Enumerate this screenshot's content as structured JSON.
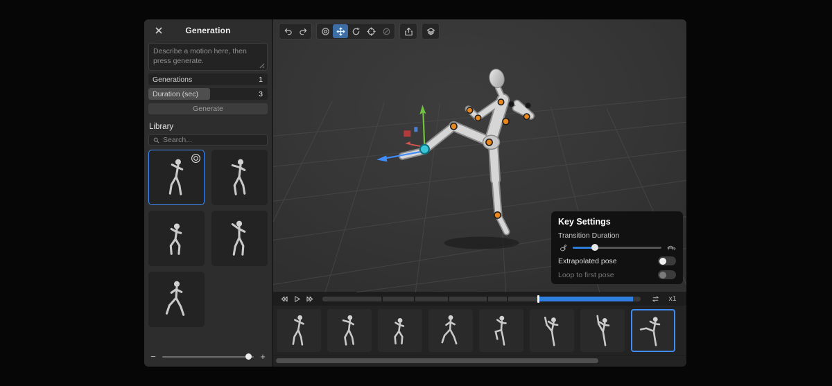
{
  "colors": {
    "accent_blue": "#3f8cfa",
    "timeline_blue": "#2f7fe0",
    "gizmo_green": "#6fc23d",
    "gizmo_blue": "#3f8cfa",
    "gizmo_red": "#d8544f",
    "joint_orange": "#e8871e",
    "selected_joint_cyan": "#39c6d8",
    "panel_bg": "#2d2d2d",
    "viewport_bg": "#363636"
  },
  "generation_panel": {
    "title": "Generation",
    "prompt_placeholder": "Describe a motion here, then press generate.",
    "generations_label": "Generations",
    "generations_value": "1",
    "duration_label": "Duration (sec)",
    "duration_value": "3",
    "duration_fill_percent": 52,
    "generate_label": "Generate",
    "library_title": "Library",
    "search_placeholder": "Search...",
    "library_items": [
      {
        "pose": "guard",
        "selected": true
      },
      {
        "pose": "jab",
        "selected": false
      },
      {
        "pose": "crouch",
        "selected": false
      },
      {
        "pose": "reach",
        "selected": false
      },
      {
        "pose": "step",
        "selected": false
      }
    ],
    "zoom_minus_label": "−",
    "zoom_plus_label": "+",
    "zoom_percent": 94
  },
  "viewport": {
    "toolbar": {
      "tools": [
        "undo",
        "redo",
        "record",
        "move",
        "rotate",
        "target",
        "disabled",
        "export",
        "layers"
      ],
      "active_tool": "move"
    },
    "key_settings": {
      "title": "Key Settings",
      "transition_duration_label": "Transition Duration",
      "transition_percent": 25,
      "extrapolated_pose_label": "Extrapolated pose",
      "extrapolated_pose_on": false,
      "loop_first_pose_label": "Loop to first pose",
      "loop_first_pose_on": false,
      "loop_first_pose_disabled": true
    }
  },
  "timeline": {
    "playhead_percent": 67.5,
    "progress_end_percent": 97.5,
    "segment_divider_percents": [
      18.5,
      28.8,
      39.4,
      51.6,
      57.9
    ],
    "speed_label": "x1",
    "scroll_thumb_percent": 78,
    "frames": [
      {
        "pose": "guard",
        "selected": false
      },
      {
        "pose": "jab",
        "selected": false
      },
      {
        "pose": "crouch",
        "selected": false
      },
      {
        "pose": "step",
        "selected": false
      },
      {
        "pose": "knee",
        "selected": false
      },
      {
        "pose": "kickhigh",
        "selected": false
      },
      {
        "pose": "kickhigh2",
        "selected": false
      },
      {
        "pose": "kick",
        "selected": true
      }
    ]
  }
}
